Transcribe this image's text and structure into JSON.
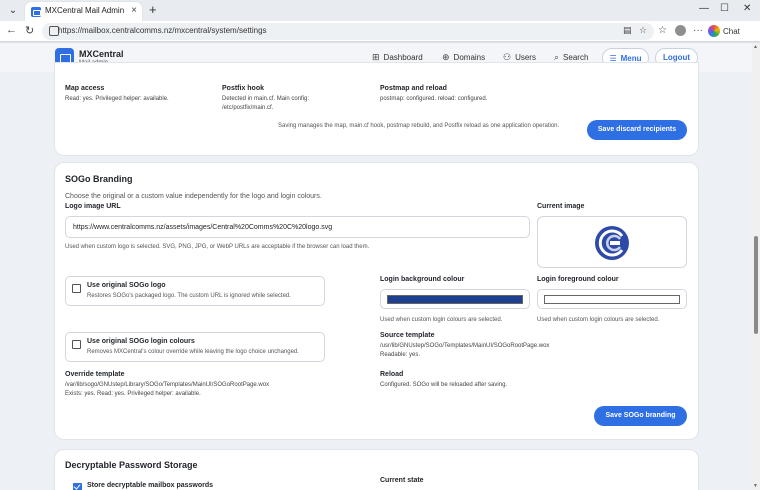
{
  "browser": {
    "tab_title": "MXCentral Mail Admin for CCL",
    "url": "https://mailbox.centralcomms.nz/mxcentral/system/settings",
    "chat_label": "Chat"
  },
  "header": {
    "brand_title": "MXCentral",
    "brand_subtitle": "Mail admin",
    "nav": {
      "dashboard": "Dashboard",
      "domains": "Domains",
      "users": "Users",
      "search": "Search"
    },
    "menu_label": "Menu",
    "logout_label": "Logout"
  },
  "postfix_card": {
    "map_access": {
      "label": "Map access",
      "value": "Read: yes. Privileged helper: available."
    },
    "postfix_hook": {
      "label": "Postfix hook",
      "line1": "Detected in main.cf. Main config:",
      "line2": "/etc/postfix/main.cf."
    },
    "postmap_reload": {
      "label": "Postmap and reload",
      "value": "postmap: configured. reload: configured."
    },
    "save_note": "Saving manages the map, main.cf hook, postmap rebuild, and Postfix reload as one application operation.",
    "save_button": "Save discard recipients"
  },
  "sogo_card": {
    "title": "SOGo Branding",
    "description": "Choose the original or a custom value independently for the logo and login colours.",
    "logo_url_label": "Logo image URL",
    "logo_url_value": "https://www.centralcomms.nz/assets/images/Central%20Comms%20C%20logo.svg",
    "logo_url_hint": "Used when custom logo is selected. SVG, PNG, JPG, or WebP URLs are acceptable if the browser can load them.",
    "current_image_label": "Current image",
    "use_original_logo": {
      "label": "Use original SOGo logo",
      "desc": "Restores SOGo's packaged logo. The custom URL is ignored while selected."
    },
    "login_bg": {
      "label": "Login background colour",
      "hint": "Used when custom login colours are selected.",
      "color": "#1f3f8f"
    },
    "login_fg": {
      "label": "Login foreground colour",
      "hint": "Used when custom login colours are selected.",
      "color": "#ffffff"
    },
    "use_original_colours": {
      "label": "Use original SOGo login colours",
      "desc": "Removes MXCentral's colour override while leaving the logo choice unchanged."
    },
    "source_template": {
      "label": "Source template",
      "path": "/usr/lib/GNUstep/SOGo/Templates/MainUI/SOGoRootPage.wox",
      "status": "Readable: yes."
    },
    "override_template": {
      "label": "Override template",
      "path": "/var/lib/sogo/GNUstep/Library/SOGo/Templates/MainUI/SOGoRootPage.wox",
      "status": "Exists: yes. Read: yes. Privileged helper: available."
    },
    "reload": {
      "label": "Reload",
      "value": "Configured. SOGo will be reloaded after saving."
    },
    "save_button": "Save SOGo branding"
  },
  "password_card": {
    "title": "Decryptable Password Storage",
    "store_checkbox": "Store decryptable mailbox passwords",
    "current_state_label": "Current state"
  },
  "colors": {
    "accent": "#2f6fe4",
    "brand_logo": "#2e4aa8"
  }
}
